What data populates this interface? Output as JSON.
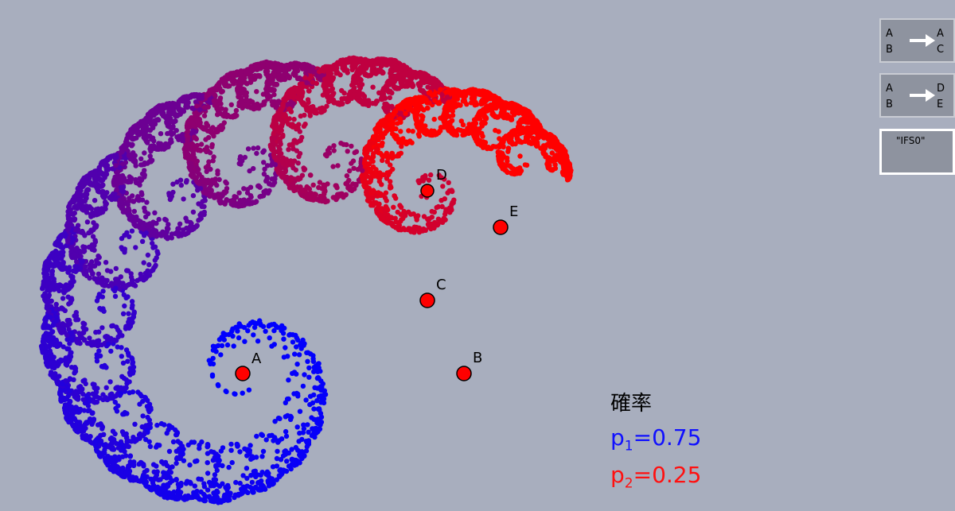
{
  "points": [
    {
      "label": "A",
      "color": "#ff0000"
    },
    {
      "label": "B",
      "color": "#ff0000"
    },
    {
      "label": "C",
      "color": "#ff0000"
    },
    {
      "label": "D",
      "color": "#ff0000"
    },
    {
      "label": "E",
      "color": "#ff0000"
    }
  ],
  "side_buttons": {
    "map1": {
      "from_top": "A",
      "from_bottom": "B",
      "to_top": "A",
      "to_bottom": "C"
    },
    "map2": {
      "from_top": "A",
      "from_bottom": "B",
      "to_top": "D",
      "to_bottom": "E"
    },
    "ifs_label": "\"IFS0\""
  },
  "probability": {
    "title": "確率",
    "p1_symbol": "p",
    "p1_sub": "1",
    "p1_eq": "=",
    "p1_value": "0.75",
    "p1_color": "#1010ff",
    "p2_symbol": "p",
    "p2_sub": "2",
    "p2_eq": "=",
    "p2_value": "0.25",
    "p2_color": "#ff1010"
  },
  "fractal": {
    "start_color": "#0000ff",
    "end_color": "#ff0000"
  }
}
